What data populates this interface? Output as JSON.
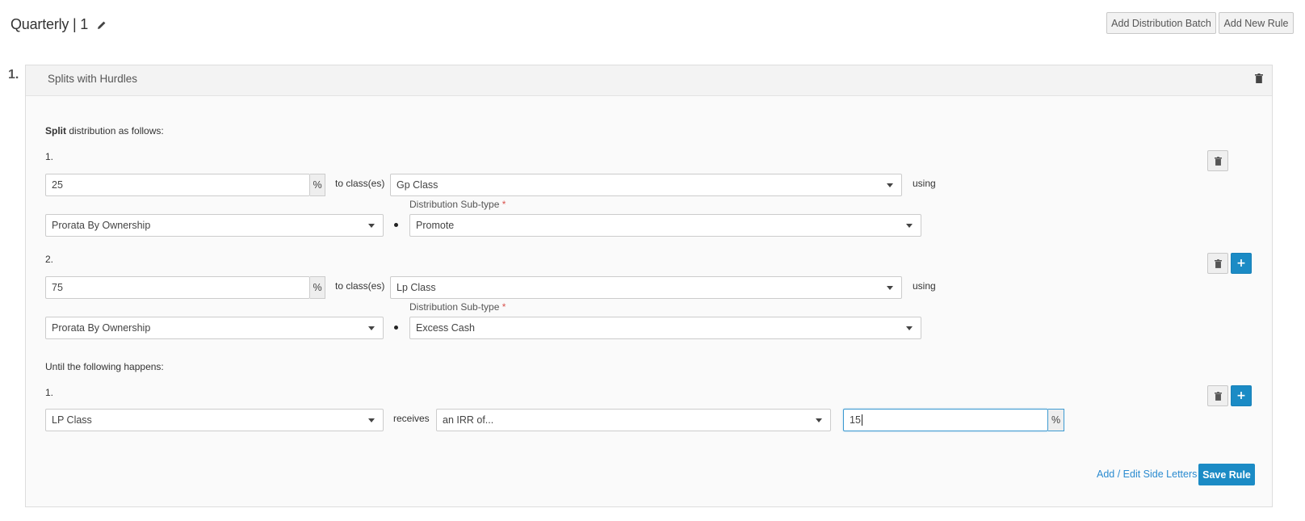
{
  "header": {
    "title": "Quarterly | 1",
    "edit_icon": "pencil-icon",
    "add_distribution_batch": "Add Distribution Batch",
    "add_new_rule": "Add New Rule"
  },
  "rule": {
    "number": "1.",
    "title": "Splits with Hurdles",
    "delete_icon": "trash-icon",
    "split_intro_bold": "Split",
    "split_intro_rest": " distribution as follows:",
    "splits": [
      {
        "index": "1.",
        "percent": "25",
        "percent_suffix": "%",
        "to_classes_label": "to class(es)",
        "class": "Gp Class",
        "using_label": "using",
        "subtype_label": "Distribution Sub-type",
        "required_mark": "*",
        "method": "Prorata By Ownership",
        "subtype": "Promote"
      },
      {
        "index": "2.",
        "percent": "75",
        "percent_suffix": "%",
        "to_classes_label": "to class(es)",
        "class": "Lp Class",
        "using_label": "using",
        "subtype_label": "Distribution Sub-type",
        "required_mark": "*",
        "method": "Prorata By Ownership",
        "subtype": "Excess Cash"
      }
    ],
    "until_label": "Until the following happens:",
    "hurdles": [
      {
        "index": "1.",
        "class": "LP Class",
        "receives_label": "receives",
        "condition": "an IRR of...",
        "value": "15",
        "value_suffix": "%"
      }
    ],
    "side_letters_link": "Add / Edit Side Letters",
    "save_label": "Save Rule",
    "add_label": "+"
  },
  "colors": {
    "accent": "#1b8bc5",
    "link": "#2a8bd0",
    "required": "#d9534f"
  }
}
